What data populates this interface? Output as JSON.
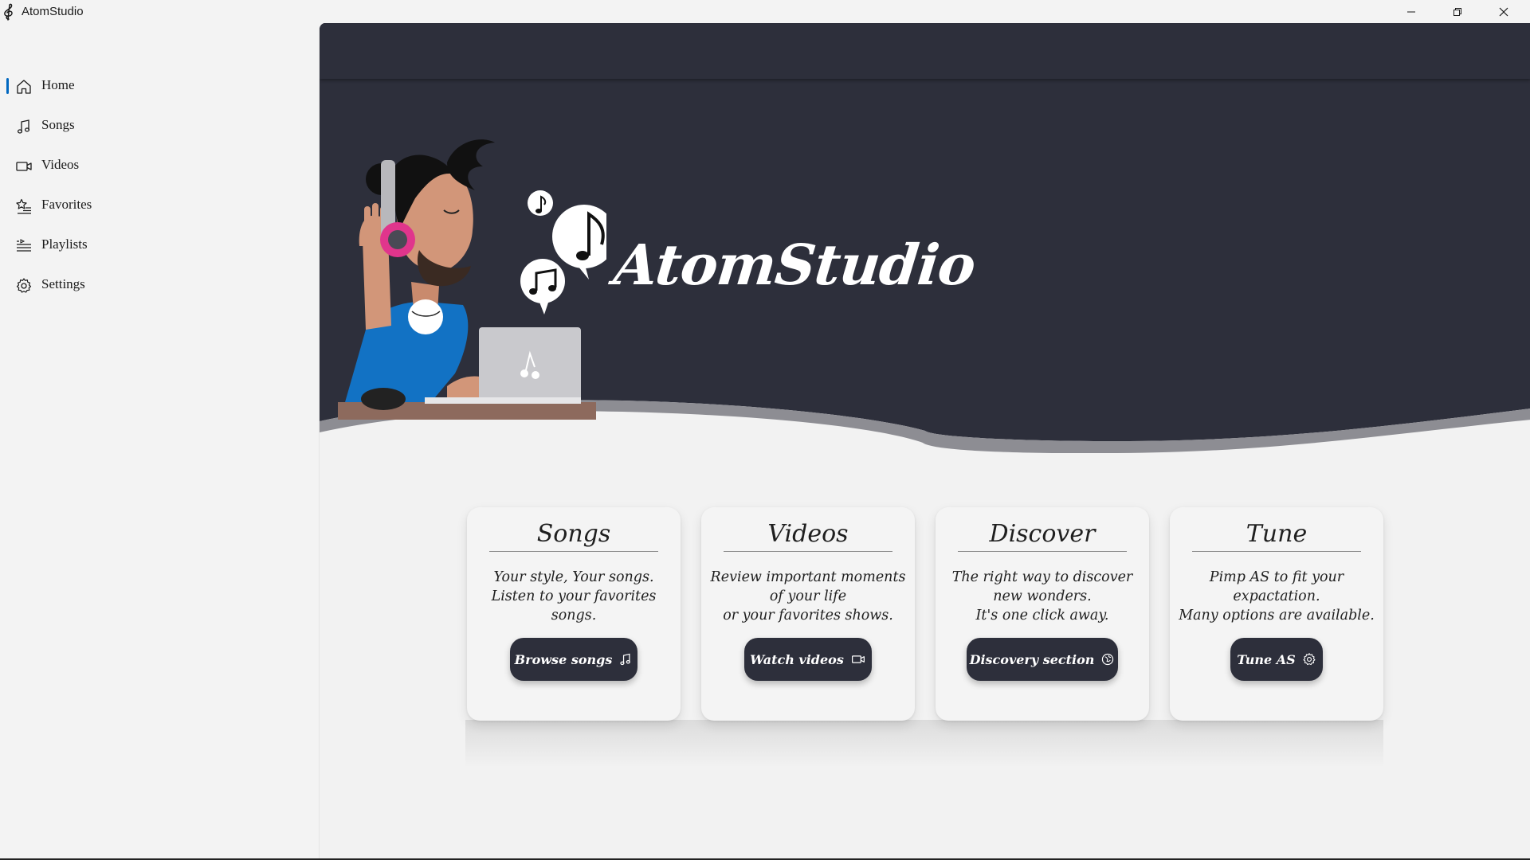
{
  "window": {
    "title": "AtomStudio",
    "controls": [
      "minimize",
      "restore",
      "close"
    ]
  },
  "sidebar": {
    "items": [
      {
        "label": "Home",
        "icon": "home-icon",
        "selected": true
      },
      {
        "label": "Songs",
        "icon": "music-note-icon",
        "selected": false
      },
      {
        "label": "Videos",
        "icon": "video-camera-icon",
        "selected": false
      },
      {
        "label": "Favorites",
        "icon": "star-list-icon",
        "selected": false
      },
      {
        "label": "Playlists",
        "icon": "playlist-icon",
        "selected": false
      },
      {
        "label": "Settings",
        "icon": "gear-icon",
        "selected": false
      }
    ]
  },
  "hero": {
    "title": "AtomStudio",
    "illustration": "person-with-headphones-and-laptop"
  },
  "cards": [
    {
      "title": "Songs",
      "description": "Your style, Your songs.\nListen to your favorites\nsongs.",
      "button_label": "Browse songs",
      "button_icon": "music-note-icon"
    },
    {
      "title": "Videos",
      "description": "Review important moments\nof your life\nor your favorites shows.",
      "button_label": "Watch videos",
      "button_icon": "video-camera-icon"
    },
    {
      "title": "Discover",
      "description": "The right way to discover\nnew wonders.\nIt's one click away.",
      "button_label": "Discovery section",
      "button_icon": "compass-globe-icon"
    },
    {
      "title": "Tune",
      "description": "Pimp AS to fit your\nexpactation.\nMany options are available.",
      "button_label": "Tune AS",
      "button_icon": "gear-icon"
    }
  ],
  "colors": {
    "accent": "#0067c0",
    "hero_background": "#2d2f3b",
    "content_background": "#f2f2f2",
    "card_background": "#f4f4f4",
    "button_background": "#2d2f3b"
  }
}
